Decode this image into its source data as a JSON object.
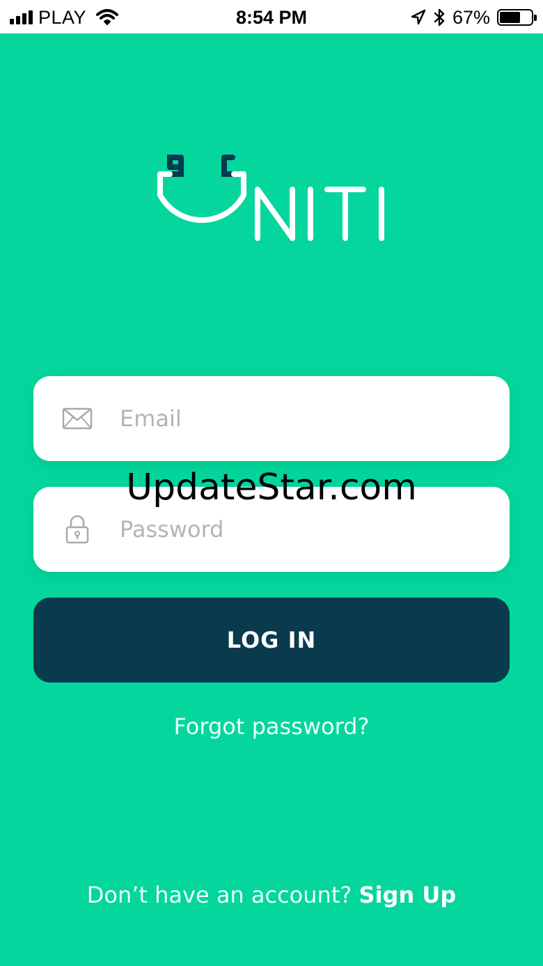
{
  "status_bar": {
    "carrier": "PLAY",
    "time": "8:54 PM",
    "battery_text": "67%",
    "battery_level": 0.67,
    "icons": [
      "signal-bars-icon",
      "wifi-icon",
      "location-arrow-icon",
      "bluetooth-icon",
      "battery-icon"
    ]
  },
  "colors": {
    "background": "#04d69d",
    "button": "#093a4e",
    "logo_accent": "#093a4e",
    "logo_main": "#ffffff",
    "placeholder": "#b4b4b4"
  },
  "logo": {
    "text": "UNITI",
    "icon": "stethoscope-u-icon"
  },
  "form": {
    "email": {
      "value": "",
      "placeholder": "Email",
      "icon": "envelope-icon"
    },
    "password": {
      "value": "",
      "placeholder": "Password",
      "icon": "lock-icon"
    },
    "login_label": "LOG IN",
    "forgot_label": "Forgot password?"
  },
  "footer": {
    "prompt": "Don’t have an account?",
    "signup_label": "Sign Up"
  },
  "watermark": "UpdateStar.com"
}
